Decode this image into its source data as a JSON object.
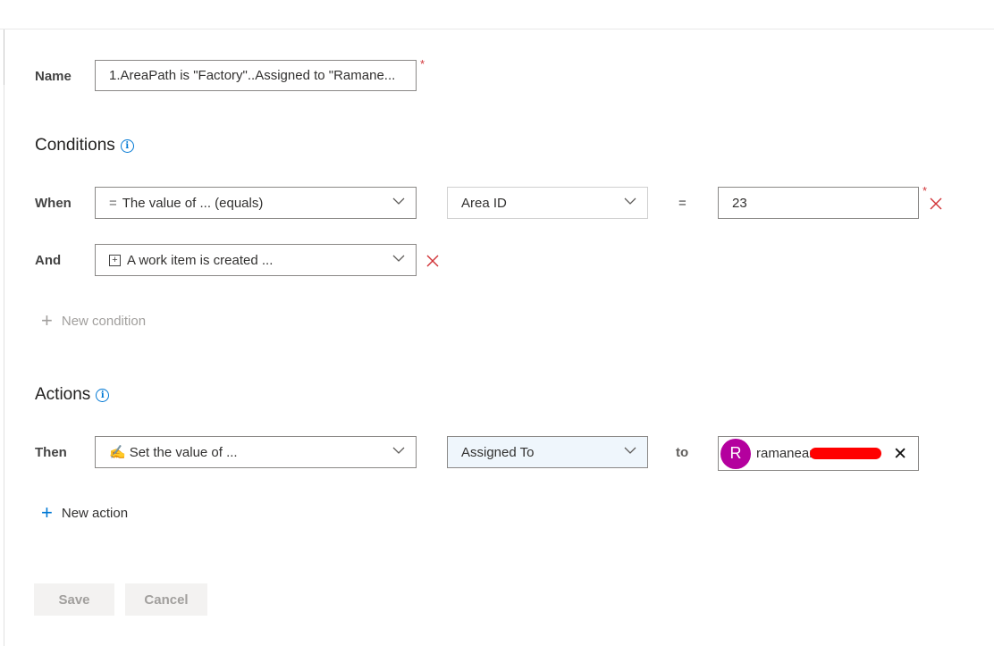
{
  "name_row": {
    "label": "Name",
    "value": "1.AreaPath is \"Factory\"..Assigned to \"Ramane...",
    "required_mark": "*"
  },
  "conditions": {
    "heading": "Conditions",
    "info_glyph": "i",
    "when": {
      "label": "When",
      "rule_glyph": "=",
      "rule": "The value of ... (equals)",
      "field": "Area ID",
      "operator": "=",
      "value": "23",
      "required_mark": "*"
    },
    "and": {
      "label": "And",
      "rule_glyph": "+",
      "rule": "A work item is created ..."
    },
    "new_label": "New condition",
    "plus_glyph": "+"
  },
  "actions": {
    "heading": "Actions",
    "info_glyph": "i",
    "then": {
      "label": "Then",
      "rule_glyph": "✍",
      "rule": "Set the value of ...",
      "field": "Assigned To",
      "connector": "to",
      "identity_initial": "R",
      "identity_name": "ramanear",
      "remove_glyph": "✕"
    },
    "new_label": "New action",
    "plus_glyph": "+"
  },
  "buttons": {
    "save": "Save",
    "cancel": "Cancel"
  },
  "colors": {
    "accent": "#0078d4",
    "error": "#d13438",
    "avatar": "#b4009e",
    "redaction": "#ff0000"
  }
}
